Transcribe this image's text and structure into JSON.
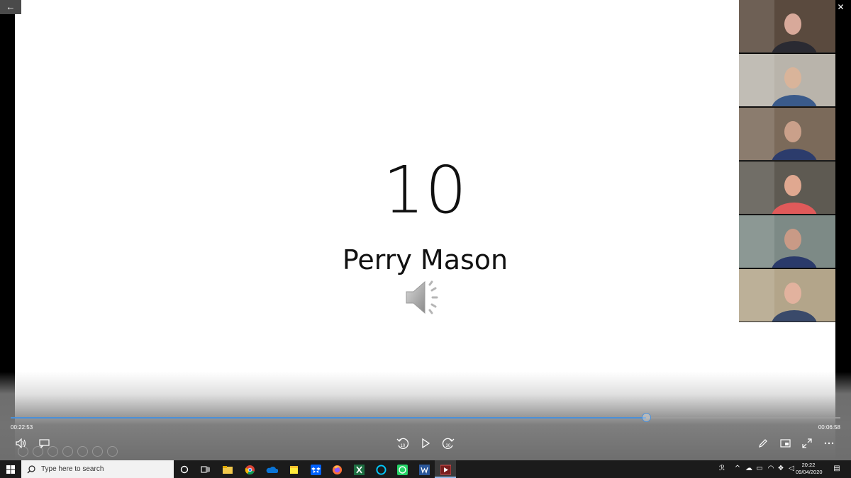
{
  "slide": {
    "number": "10",
    "title": "Perry Mason"
  },
  "window": {
    "back_icon": "back-arrow-icon",
    "controls": [
      "minimize-icon",
      "restore-icon",
      "close-icon"
    ]
  },
  "gallery": {
    "participants": [
      {
        "id": "participant-1",
        "bg": "#5a4a3e",
        "skin": "#d8a99a",
        "shirt": "#2a2a32"
      },
      {
        "id": "participant-2",
        "bg": "#b9b4ab",
        "skin": "#d9b49a",
        "shirt": "#3a5a8a"
      },
      {
        "id": "participant-3",
        "bg": "#7b6a5a",
        "skin": "#caa08a",
        "shirt": "#2c3c6c"
      },
      {
        "id": "participant-4",
        "bg": "#5e5a52",
        "skin": "#e0a890",
        "shirt": "#e05a5a"
      },
      {
        "id": "participant-5",
        "bg": "#7d8a86",
        "skin": "#c99a86",
        "shirt": "#2a3a6a"
      },
      {
        "id": "participant-6",
        "bg": "#b3a58a",
        "skin": "#e2b29e",
        "shirt": "#3a4a6a"
      }
    ]
  },
  "player": {
    "elapsed": "00:22:53",
    "remaining": "00:06:58",
    "progress_fraction": 0.766,
    "accent": "#4a90d9"
  },
  "taskbar": {
    "search_placeholder": "Type here to search",
    "time": "20:22",
    "date": "09/04/2020",
    "apps": [
      "cortana-icon",
      "task-view-icon",
      "file-explorer-icon",
      "chrome-icon",
      "onedrive-icon",
      "sticky-notes-icon",
      "dropbox-icon",
      "firefox-icon",
      "excel-icon",
      "alexa-icon",
      "whatsapp-icon",
      "word-icon",
      "video-player-icon"
    ]
  }
}
